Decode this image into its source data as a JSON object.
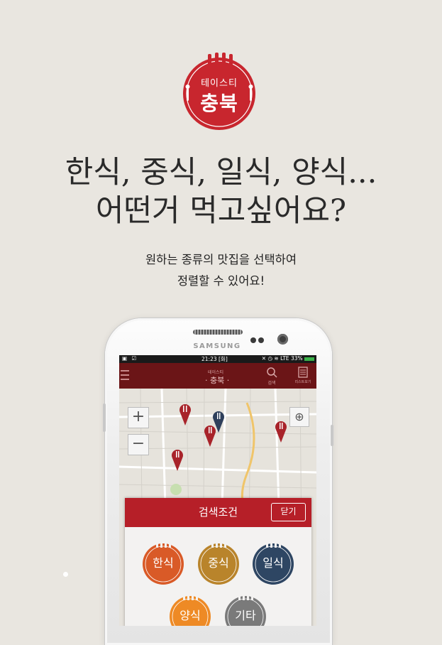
{
  "logo": {
    "sub": "테이스티",
    "main": "충북",
    "color": "#c8262e"
  },
  "headline": {
    "line1": "한식, 중식, 일식, 양식...",
    "line2": "어떤거 먹고싶어요?"
  },
  "subtext": {
    "line1": "원하는 종류의 맛집을 선택하여",
    "line2": "정렬할 수 있어요!"
  },
  "phone": {
    "brand": "SAMSUNG"
  },
  "statusbar": {
    "time": "21:23 [화]",
    "network": "LTE",
    "battery": "33%"
  },
  "appbar": {
    "logo_sub": "테이스티",
    "logo_main": "· 충북 ·",
    "search_label": "검색",
    "list_label": "리스트보기"
  },
  "map": {
    "zoom_in": "+",
    "zoom_out": "−"
  },
  "dialog": {
    "title": "검색조건",
    "close_label": "닫기",
    "categories": [
      {
        "label": "한식",
        "color": "#d95a27"
      },
      {
        "label": "중식",
        "color": "#b9842b"
      },
      {
        "label": "일식",
        "color": "#2e4663"
      },
      {
        "label": "양식",
        "color": "#ee8a25"
      },
      {
        "label": "기타",
        "color": "#7a7a7a"
      }
    ]
  },
  "colors": {
    "accent": "#b61f28",
    "appbar": "#6b1517",
    "background": "#e9e6e0"
  },
  "icons": [
    "menu-icon",
    "search-icon",
    "list-icon",
    "gps-icon",
    "map-pin-icon",
    "fork-icon"
  ]
}
